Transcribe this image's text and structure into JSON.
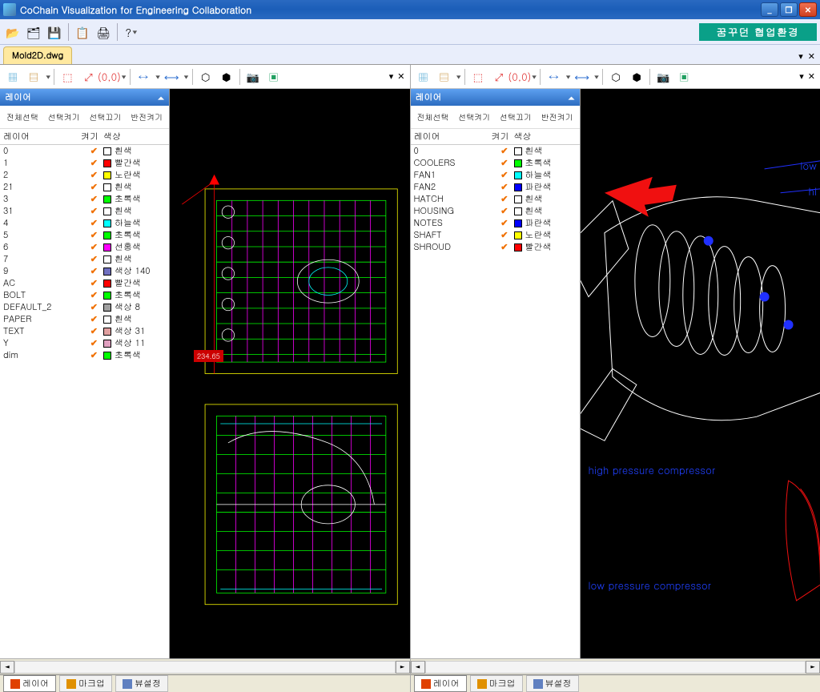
{
  "title": "CoChain Visualization for Engineering Collaboration",
  "banner": "꿈꾸던 협업환경",
  "file_tab": {
    "label": "Mold2D.dwg"
  },
  "layer_panel": {
    "header": "레이어",
    "filters": [
      "전체선택",
      "선택켜기",
      "선택끄기",
      "반전켜기"
    ],
    "columns": {
      "name": "레이어",
      "on": "켜기",
      "color": "색상"
    }
  },
  "left_layers": [
    {
      "name": "0",
      "color": "#ffffff",
      "label": "흰색"
    },
    {
      "name": "1",
      "color": "#ff0000",
      "label": "빨간색"
    },
    {
      "name": "2",
      "color": "#ffff00",
      "label": "노란색"
    },
    {
      "name": "21",
      "color": "#ffffff",
      "label": "흰색"
    },
    {
      "name": "3",
      "color": "#00ff00",
      "label": "초록색"
    },
    {
      "name": "31",
      "color": "#ffffff",
      "label": "흰색"
    },
    {
      "name": "4",
      "color": "#00ffff",
      "label": "하늘색"
    },
    {
      "name": "5",
      "color": "#00ff00",
      "label": "초록색"
    },
    {
      "name": "6",
      "color": "#ff00ff",
      "label": "선홍색"
    },
    {
      "name": "7",
      "color": "#ffffff",
      "label": "흰색"
    },
    {
      "name": "9",
      "color": "#7070c0",
      "label": "색상 140"
    },
    {
      "name": "AC",
      "color": "#ff0000",
      "label": "빨간색"
    },
    {
      "name": "BOLT",
      "color": "#00ff00",
      "label": "초록색"
    },
    {
      "name": "DEFAULT_2",
      "color": "#a0a0a0",
      "label": "색상 8"
    },
    {
      "name": "PAPER",
      "color": "#ffffff",
      "label": "흰색"
    },
    {
      "name": "TEXT",
      "color": "#e0a0a0",
      "label": "색상 31"
    },
    {
      "name": "Y",
      "color": "#e0a0c0",
      "label": "색상 11"
    },
    {
      "name": "dim",
      "color": "#00ff00",
      "label": "초록색"
    }
  ],
  "right_layers": [
    {
      "name": "0",
      "color": "#ffffff",
      "label": "흰색"
    },
    {
      "name": "COOLERS",
      "color": "#00ff00",
      "label": "초록색"
    },
    {
      "name": "FAN1",
      "color": "#00ffff",
      "label": "하늘색"
    },
    {
      "name": "FAN2",
      "color": "#0000ff",
      "label": "파란색"
    },
    {
      "name": "HATCH",
      "color": "#ffffff",
      "label": "흰색"
    },
    {
      "name": "HOUSING",
      "color": "#ffffff",
      "label": "흰색"
    },
    {
      "name": "NOTES",
      "color": "#0000ff",
      "label": "파란색"
    },
    {
      "name": "SHAFT",
      "color": "#ffff00",
      "label": "노란색"
    },
    {
      "name": "SHROUD",
      "color": "#ff0000",
      "label": "빨간색"
    }
  ],
  "left_canvas": {
    "dimension_label": "234.65"
  },
  "right_canvas": {
    "annotations": {
      "low_top": "low",
      "hi_top": "hi",
      "hp_compressor": "high pressure compressor",
      "lp_compressor": "low pressure compressor"
    }
  },
  "bottom_tabs": [
    {
      "label": "레이어",
      "icon_color": "#e04000"
    },
    {
      "label": "마크업",
      "icon_color": "#e09000"
    },
    {
      "label": "뷰설정",
      "icon_color": "#6080c0"
    }
  ]
}
